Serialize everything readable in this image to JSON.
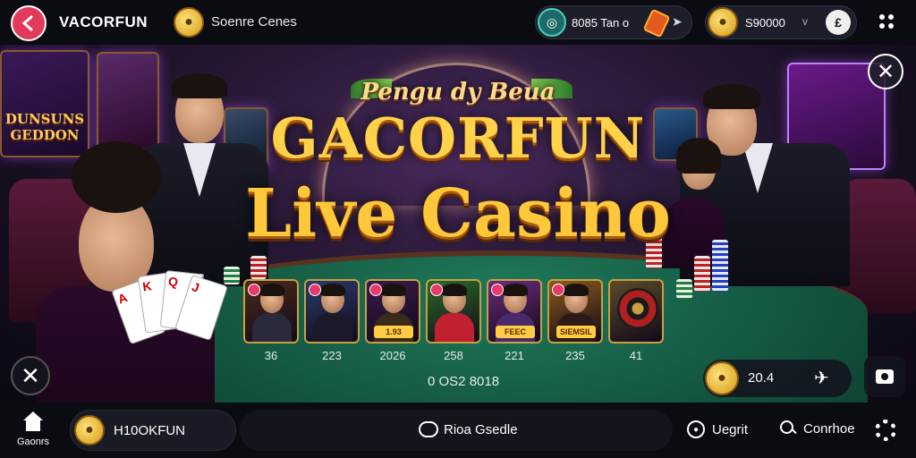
{
  "topbar": {
    "brand": "VACORFUN",
    "games_label": "Soenre Cenes",
    "stat_text": "8085 Tan o",
    "balance": "S90000",
    "balance_chevron": "v",
    "bank_glyph": "£",
    "icons": [
      "back-arrow-icon",
      "coin-icon",
      "ring-icon",
      "ticket-icon",
      "arrow-icon",
      "bank-icon",
      "grid-icon"
    ]
  },
  "hero": {
    "subtitle": "Pengu dy Beua",
    "title_line1": "GACORFUN",
    "title_line2": "Live Casino"
  },
  "posters": {
    "left_poster_text": "DUNSUNS GEDDON"
  },
  "tiles": [
    {
      "number": "36",
      "tag": "",
      "body_color": "#2a2a3a",
      "bg": "#4a2a1a"
    },
    {
      "number": "223",
      "tag": "",
      "body_color": "#1a1a2a",
      "bg": "#2a3a6a"
    },
    {
      "number": "2026",
      "tag": "1.93",
      "body_color": "#3a2a1a",
      "bg": "#3a1a4a"
    },
    {
      "number": "258",
      "tag": "",
      "body_color": "#c02030",
      "bg": "#2a6a2a"
    },
    {
      "number": "221",
      "tag": "FEEC",
      "body_color": "#4a2a6a",
      "bg": "#6a2a7a"
    },
    {
      "number": "235",
      "tag": "SIEMSIL",
      "body_color": "#2a1a1a",
      "bg": "#8a5a1a"
    },
    {
      "number": "41",
      "tag": "",
      "body_color": "#1a1a1a",
      "bg": "#5a4a2a"
    }
  ],
  "counter": "0 OS2 8018",
  "score": {
    "value": "20.4"
  },
  "bottombar": {
    "home_label": "Gaonrs",
    "user_name": "H10OKFUN",
    "chat_text": "Rioa Gsedle",
    "nav_item_1": "Uegrit",
    "nav_item_2": "Conrhoe"
  },
  "colors": {
    "accent": "#ffc83a",
    "back_button": "#e23a5a",
    "table_felt": "#1f7a5a"
  }
}
